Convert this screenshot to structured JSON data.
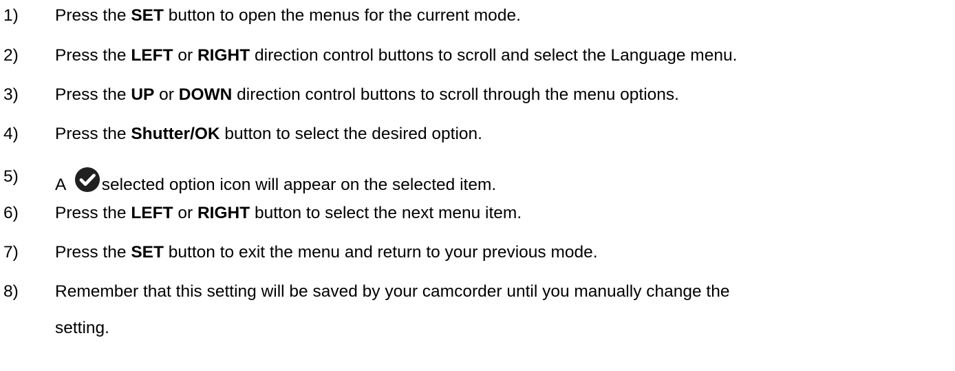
{
  "steps": [
    {
      "number": "1)",
      "parts": [
        "Press the ",
        "SET",
        " button to open the menus for the current mode."
      ]
    },
    {
      "number": "2)",
      "parts": [
        "Press the ",
        "LEFT",
        " or ",
        "RIGHT",
        " direction control buttons to scroll and select the Language menu."
      ]
    },
    {
      "number": "3)",
      "parts": [
        "Press the ",
        "UP",
        " or ",
        "DOWN",
        " direction control buttons to scroll through the menu options."
      ]
    },
    {
      "number": "4)",
      "parts": [
        "Press the ",
        "Shutter/OK",
        " button to select the desired option."
      ]
    },
    {
      "number": "5)",
      "parts": [
        "A ",
        "selected option icon will appear on the selected item."
      ],
      "icon": "check-circle-icon"
    },
    {
      "number": "6)",
      "parts": [
        "Press the ",
        "LEFT",
        " or ",
        "RIGHT",
        " button to select the next menu item."
      ]
    },
    {
      "number": "7)",
      "parts": [
        "Press the ",
        "SET",
        " button to exit the menu and return to your previous mode."
      ]
    },
    {
      "number": "8)",
      "parts": [
        "Remember that this setting will be saved by your camcorder until you manually change the"
      ],
      "continuation": "setting."
    }
  ]
}
